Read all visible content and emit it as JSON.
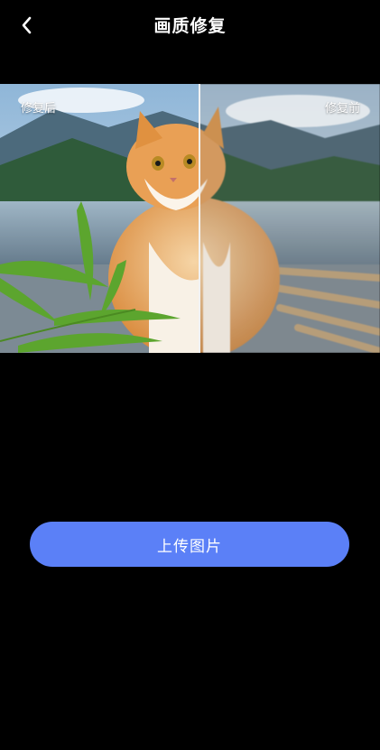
{
  "header": {
    "title": "画质修复",
    "back_icon": "chevron-left-icon"
  },
  "compare": {
    "after_label": "修复后",
    "before_label": "修复前",
    "divider_fraction": 0.525
  },
  "actions": {
    "upload_label": "上传图片"
  },
  "colors": {
    "background": "#000000",
    "accent": "#5b80f7",
    "text": "#ffffff"
  }
}
